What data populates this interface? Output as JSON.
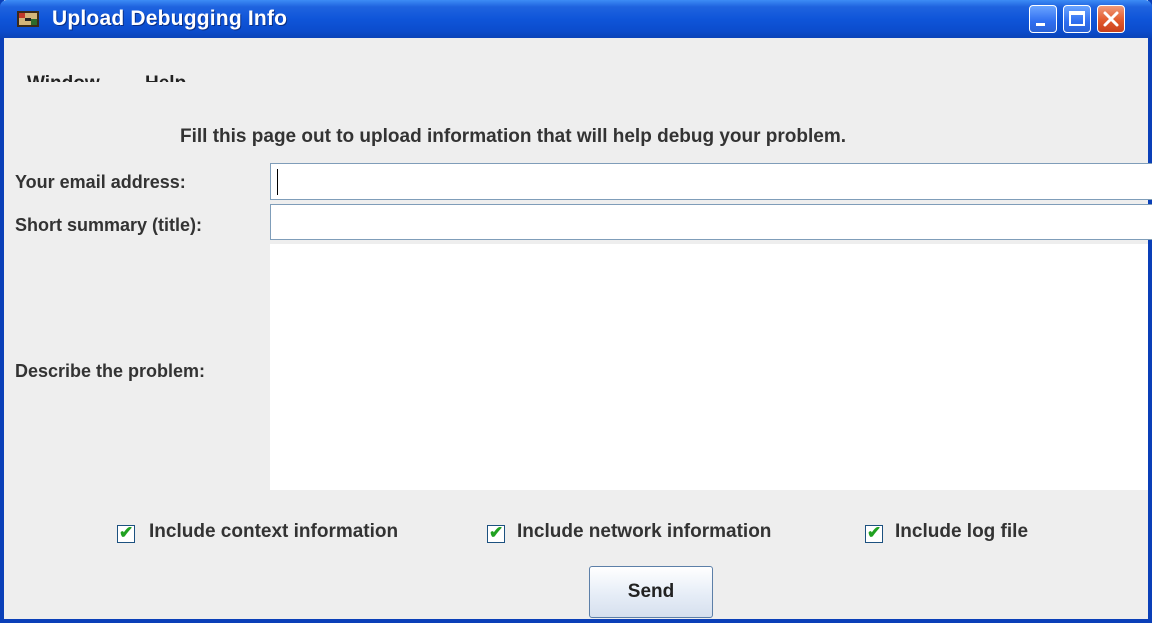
{
  "window": {
    "title": "Upload Debugging Info",
    "title_color": "#ffffff",
    "frame_color": "#0a3fb8"
  },
  "titlebar_buttons": [
    "minimize-icon",
    "maximize-icon",
    "close-icon"
  ],
  "menu": {
    "items": [
      "Window",
      "Help"
    ]
  },
  "form": {
    "instructions": "Fill this page out to upload information that will help debug your problem.",
    "email": {
      "label": "Your email address:",
      "value": ""
    },
    "summary": {
      "label": "Short summary (title):",
      "value": ""
    },
    "description": {
      "label": "Describe the problem:",
      "value": ""
    }
  },
  "options": [
    {
      "label": "Include context information",
      "checked": true
    },
    {
      "label": "Include network information",
      "checked": true
    },
    {
      "label": "Include log file",
      "checked": true
    }
  ],
  "send_label": "Send",
  "checkmark_glyph": "✔"
}
